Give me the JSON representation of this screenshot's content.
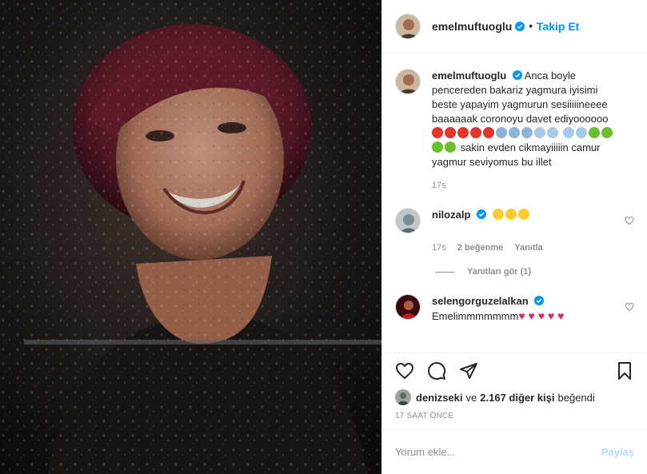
{
  "post": {
    "username": "emelmuftuoglu",
    "follow_label": "Takip Et",
    "dot": "•",
    "caption": "Anca boyle pencereden bakariz yagmura iyisimi beste yapayim yagmurun sesiiiiineeee baaaaaak coronoyu davet ediyoooooo",
    "caption_tail": "sakin evden cikmayiiiiin camur yagmur seviyomus bu illet",
    "caption_time": "17s"
  },
  "icons": {
    "verified": "verified-badge-icon",
    "like": "heart-icon",
    "comment": "speech-bubble-icon",
    "share": "paper-plane-icon",
    "save": "bookmark-icon"
  },
  "comments": [
    {
      "username": "nilozalp",
      "emoji_text": "",
      "time": "17s",
      "likes": "2 beğenme",
      "reply": "Yanıtla",
      "view_replies": "Yanıtları gör (1)"
    },
    {
      "username": "selengorguzelalkan",
      "text": "Emelimmmmmmm"
    }
  ],
  "likes_bar": {
    "user": "denizseki",
    "connector": "ve",
    "count": "2.167 diğer kişi",
    "suffix": "beğendi"
  },
  "time_ago": "17 SAAT ÖNCE",
  "add_comment": {
    "placeholder": "Yorum ekle...",
    "post_label": "Paylaş"
  },
  "colors": {
    "accent": "#0095f6",
    "post_disabled": "#b2dffc",
    "muted": "#8e8e8e"
  }
}
